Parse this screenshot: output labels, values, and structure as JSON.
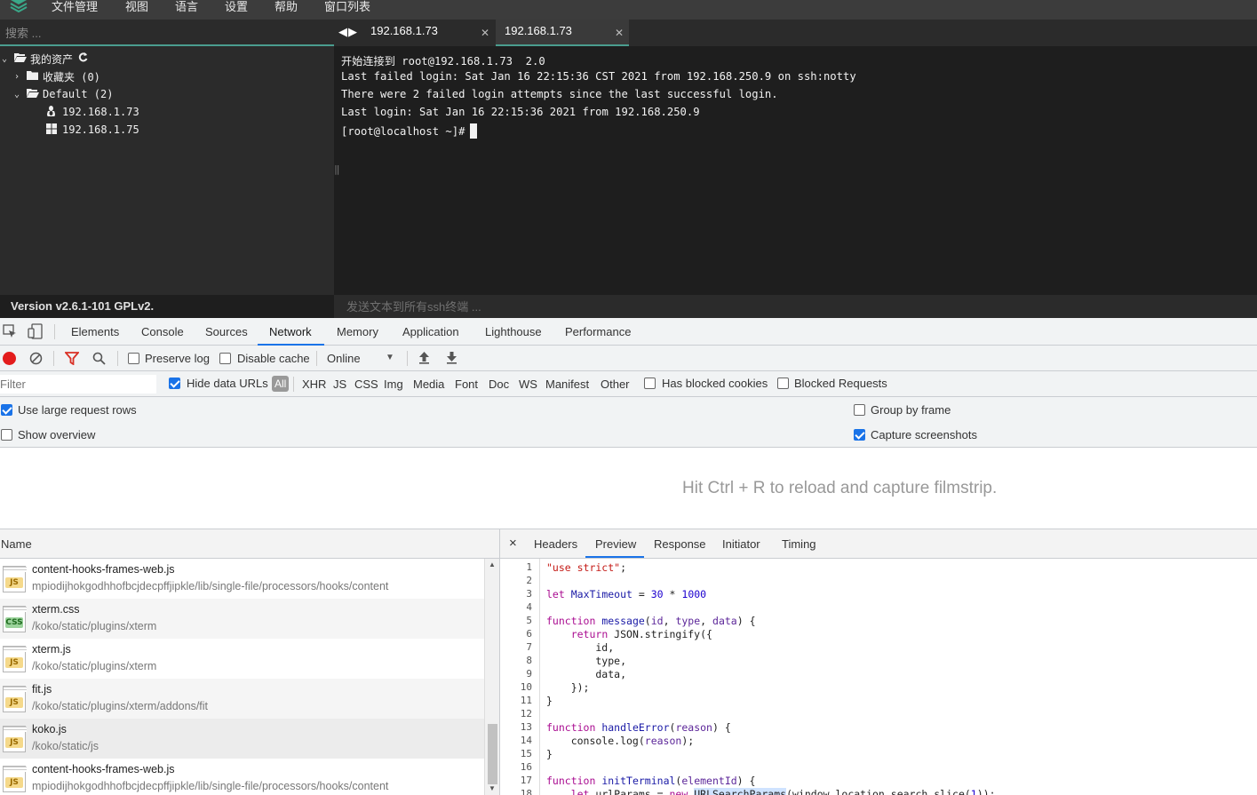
{
  "menubar": {
    "items": [
      "文件管理",
      "视图",
      "语言",
      "设置",
      "帮助",
      "窗口列表"
    ]
  },
  "sidebar": {
    "search_placeholder": "搜索 ...",
    "tree": {
      "root_label": "我的资产",
      "favorites_label": "收藏夹 (0)",
      "default_label": "Default (2)",
      "hosts": [
        "192.168.1.73",
        "192.168.1.75"
      ]
    },
    "version": "Version v2.6.1-101 GPLv2."
  },
  "terminal_tabs": [
    {
      "label": "192.168.1.73",
      "active": false
    },
    {
      "label": "192.168.1.73",
      "active": true
    }
  ],
  "terminal": {
    "lines": [
      "开始连接到 root@192.168.1.73  2.0",
      "Last failed login: Sat Jan 16 22:15:36 CST 2021 from 192.168.250.9 on ssh:notty",
      "There were 2 failed login attempts since the last successful login.",
      "Last login: Sat Jan 16 22:15:36 2021 from 192.168.250.9",
      "[root@localhost ~]#"
    ]
  },
  "send_bar": {
    "placeholder": "发送文本到所有ssh终端 ..."
  },
  "devtools": {
    "tabs": [
      "Elements",
      "Console",
      "Sources",
      "Network",
      "Memory",
      "Application",
      "Lighthouse",
      "Performance"
    ],
    "active_tab": "Network",
    "toolbar": {
      "preserve_log": "Preserve log",
      "disable_cache": "Disable cache",
      "throttle": "Online"
    },
    "filter": {
      "placeholder": "Filter",
      "hide_data_urls": "Hide data URLs",
      "all": "All",
      "types": [
        "XHR",
        "JS",
        "CSS",
        "Img",
        "Media",
        "Font",
        "Doc",
        "WS",
        "Manifest",
        "Other"
      ],
      "has_blocked_cookies": "Has blocked cookies",
      "blocked_requests": "Blocked Requests"
    },
    "settings": {
      "use_large_rows": "Use large request rows",
      "show_overview": "Show overview",
      "group_by_frame": "Group by frame",
      "capture_screenshots": "Capture screenshots"
    },
    "filmstrip_hint": "Hit Ctrl + R to reload and capture filmstrip.",
    "name_header": "Name",
    "requests": [
      {
        "name": "content-hooks-frames-web.js",
        "path": "mpiodijhokgodhhofbcjdecpffjipkle/lib/single-file/processors/hooks/content",
        "type": "JS"
      },
      {
        "name": "xterm.css",
        "path": "/koko/static/plugins/xterm",
        "type": "CSS"
      },
      {
        "name": "xterm.js",
        "path": "/koko/static/plugins/xterm",
        "type": "JS"
      },
      {
        "name": "fit.js",
        "path": "/koko/static/plugins/xterm/addons/fit",
        "type": "JS"
      },
      {
        "name": "koko.js",
        "path": "/koko/static/js",
        "type": "JS"
      },
      {
        "name": "content-hooks-frames-web.js",
        "path": "mpiodijhokgodhhofbcjdecpffjipkle/lib/single-file/processors/hooks/content",
        "type": "JS"
      }
    ],
    "detail_tabs": [
      "Headers",
      "Preview",
      "Response",
      "Initiator",
      "Timing"
    ],
    "active_detail_tab": "Preview",
    "close_glyph": "×",
    "code_line_numbers": [
      "1",
      "2",
      "3",
      "4",
      "5",
      "6",
      "7",
      "8",
      "9",
      "10",
      "11",
      "12",
      "13",
      "14",
      "15",
      "16",
      "17",
      "18"
    ]
  },
  "colors": {
    "accent": "#4a9d8f",
    "devtools_blue": "#1a73e8"
  }
}
